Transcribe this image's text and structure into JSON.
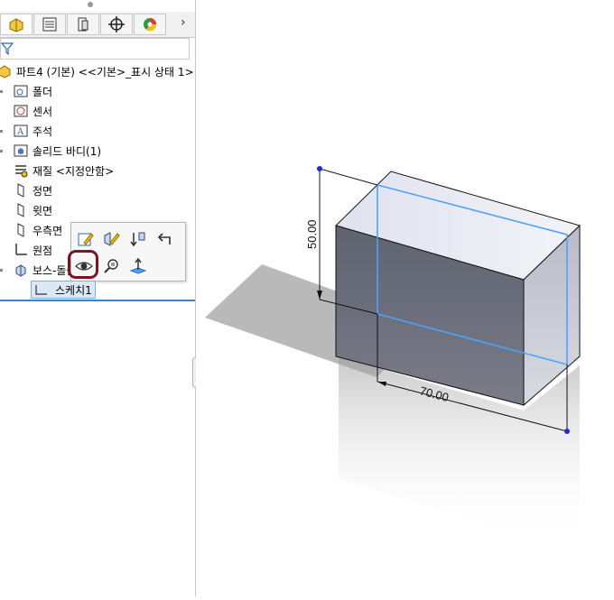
{
  "tree": {
    "root_label": "파트4 (기본) <<기본>_표시 상태 1>",
    "items": [
      {
        "label": "폴더",
        "icon": "folder-icon"
      },
      {
        "label": "센서",
        "icon": "sensor-icon"
      },
      {
        "label": "주석",
        "icon": "annotation-icon"
      },
      {
        "label": "솔리드 바디(1)",
        "icon": "solid-body-icon"
      },
      {
        "label": "재질 <지정안함>",
        "icon": "material-icon"
      },
      {
        "label": "정면",
        "icon": "plane-icon"
      },
      {
        "label": "윗면",
        "icon": "plane-icon"
      },
      {
        "label": "우측면",
        "icon": "plane-icon"
      },
      {
        "label": "원점",
        "icon": "origin-icon"
      },
      {
        "label": "보스-돌출1",
        "icon": "extrude-icon"
      }
    ],
    "selected_child": "스케치1"
  },
  "tabs": [
    "feature-manager",
    "property-manager",
    "configuration-manager",
    "dimxpert-manager",
    "display-manager"
  ],
  "dimensions": {
    "height": "50.00",
    "width": "70.00"
  },
  "colors": {
    "selection_blue": "#3c84c8",
    "highlight_ring": "#7a1422",
    "sketch_line": "#4aa3ff"
  }
}
